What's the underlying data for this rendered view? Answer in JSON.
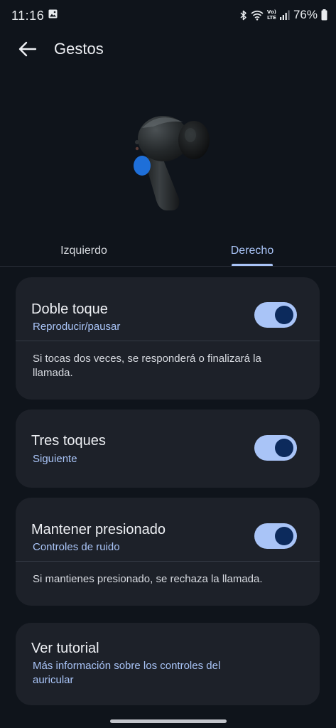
{
  "status_bar": {
    "time": "11:16",
    "battery": "76%",
    "volte_top": "Vo)",
    "volte_bottom": "LTE",
    "icons": [
      "image-icon",
      "bluetooth-icon",
      "wifi-icon",
      "signal-icon",
      "battery-icon"
    ]
  },
  "header": {
    "title": "Gestos",
    "back_icon": "arrow-left-icon"
  },
  "tabs": [
    {
      "label": "Izquierdo",
      "selected": false
    },
    {
      "label": "Derecho",
      "selected": true
    }
  ],
  "gestures": {
    "double_tap": {
      "title": "Doble toque",
      "subtitle": "Reproducir/pausar",
      "description": "Si tocas dos veces, se responderá o finalizará la llamada.",
      "enabled": true
    },
    "triple_tap": {
      "title": "Tres toques",
      "subtitle": "Siguiente",
      "enabled": true
    },
    "hold": {
      "title": "Mantener presionado",
      "subtitle": "Controles de ruido",
      "description": "Si mantienes presionado, se rechaza la llamada.",
      "enabled": true
    }
  },
  "tutorial": {
    "title": "Ver tutorial",
    "subtitle": "Más información sobre los controles del auricular"
  },
  "colors": {
    "background": "#0f141b",
    "card": "#1d2129",
    "accent": "#a9c4f7",
    "toggle_knob": "#0c2a5c",
    "highlight_blue": "#1e6fd9"
  }
}
